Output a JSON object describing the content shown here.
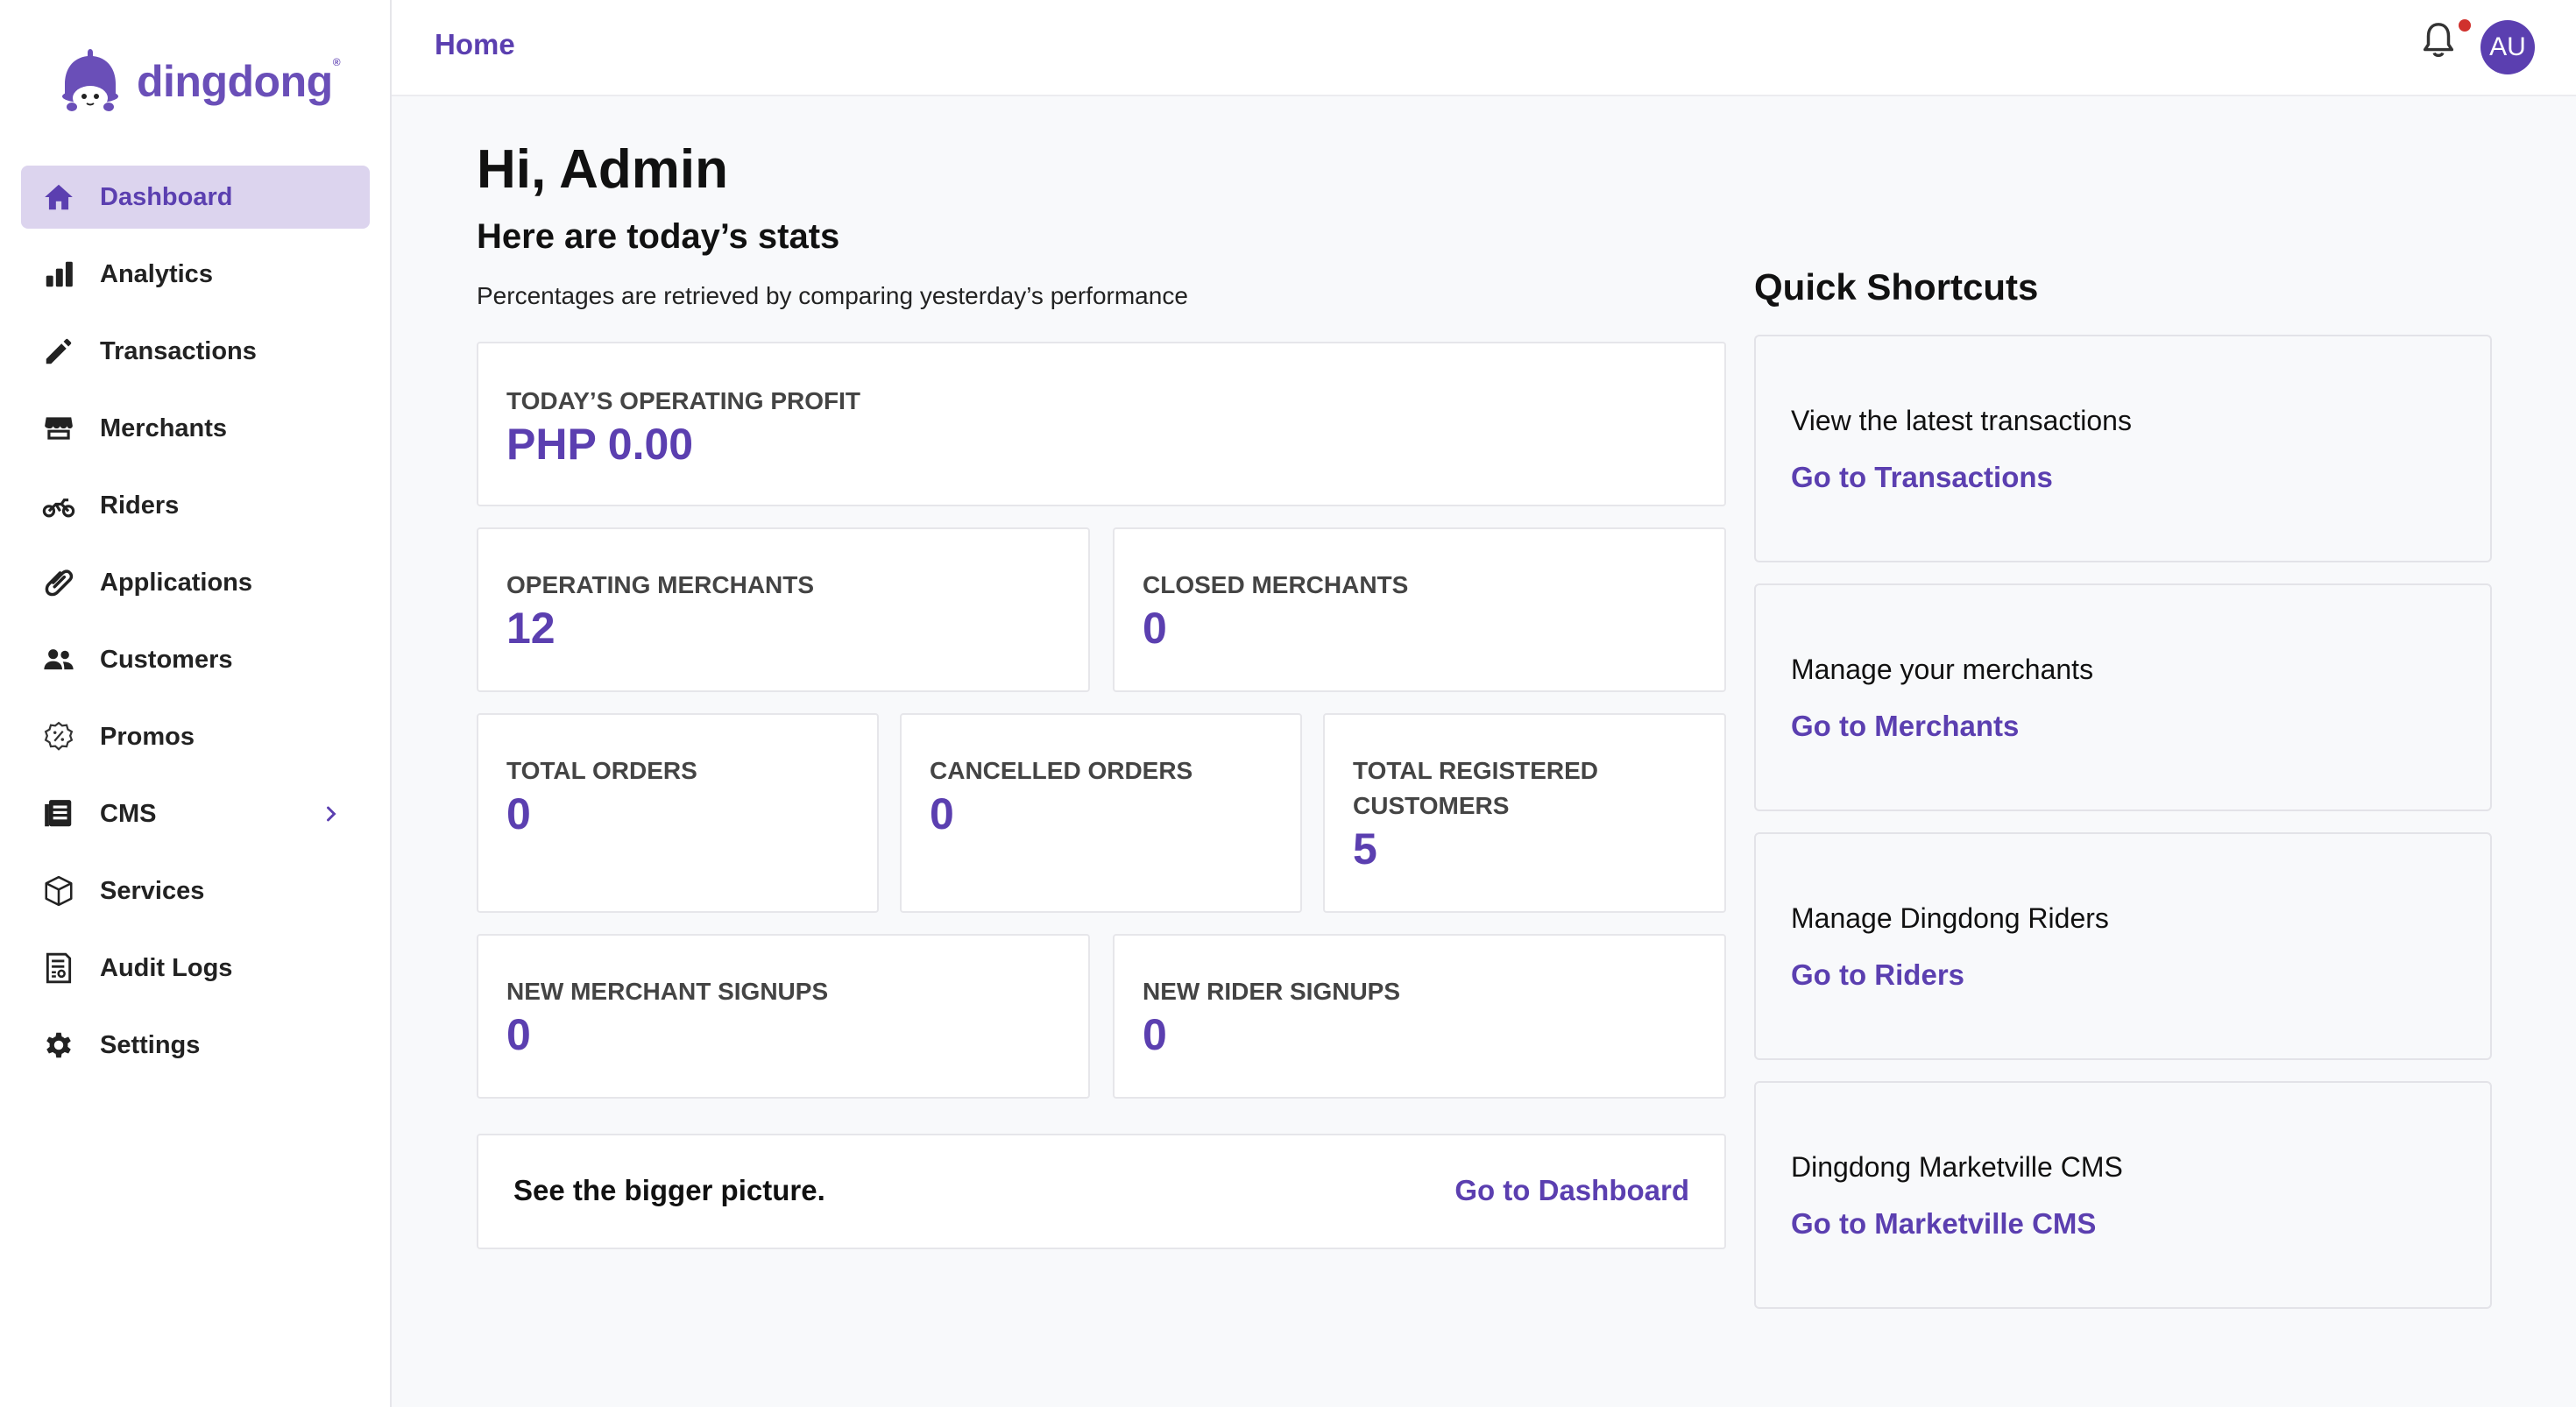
{
  "brand": {
    "name": "dingdong",
    "mark": "®",
    "accent": "#5b3fb0"
  },
  "header": {
    "breadcrumb": "Home",
    "avatar_initials": "AU",
    "notification_dot": true
  },
  "sidebar": {
    "items": [
      {
        "label": "Dashboard",
        "icon": "home-icon",
        "active": true
      },
      {
        "label": "Analytics",
        "icon": "bar-chart-icon"
      },
      {
        "label": "Transactions",
        "icon": "pencil-icon"
      },
      {
        "label": "Merchants",
        "icon": "store-icon"
      },
      {
        "label": "Riders",
        "icon": "motorcycle-icon"
      },
      {
        "label": "Applications",
        "icon": "paperclip-icon"
      },
      {
        "label": "Customers",
        "icon": "users-icon"
      },
      {
        "label": "Promos",
        "icon": "discount-badge-icon"
      },
      {
        "label": "CMS",
        "icon": "document-list-icon",
        "expandable": true
      },
      {
        "label": "Services",
        "icon": "box-icon"
      },
      {
        "label": "Audit Logs",
        "icon": "audit-log-icon"
      },
      {
        "label": "Settings",
        "icon": "gear-icon"
      }
    ]
  },
  "main": {
    "greeting": "Hi, Admin",
    "subheading": "Here are today’s stats",
    "note": "Percentages are retrieved by comparing yesterday’s performance",
    "stats": {
      "operating_profit": {
        "label": "TODAY’S OPERATING PROFIT",
        "value": "PHP 0.00"
      },
      "operating_merchants": {
        "label": "OPERATING MERCHANTS",
        "value": "12"
      },
      "closed_merchants": {
        "label": "CLOSED MERCHANTS",
        "value": "0"
      },
      "total_orders": {
        "label": "TOTAL ORDERS",
        "value": "0"
      },
      "cancelled_orders": {
        "label": "CANCELLED ORDERS",
        "value": "0"
      },
      "registered_customers": {
        "label_line1": "TOTAL REGISTERED",
        "label_line2": "CUSTOMERS",
        "value": "5"
      },
      "new_merchant_signups": {
        "label": "NEW MERCHANT SIGNUPS",
        "value": "0"
      },
      "new_rider_signups": {
        "label": "NEW RIDER SIGNUPS",
        "value": "0"
      }
    },
    "bigger_picture": {
      "text": "See the bigger picture.",
      "link": "Go to Dashboard"
    }
  },
  "shortcuts": {
    "title": "Quick Shortcuts",
    "items": [
      {
        "text": "View the latest transactions",
        "link": "Go to Transactions"
      },
      {
        "text": "Manage your merchants",
        "link": "Go to Merchants"
      },
      {
        "text": "Manage Dingdong Riders",
        "link": "Go to Riders"
      },
      {
        "text": "Dingdong Marketville CMS",
        "link": "Go to Marketville CMS"
      }
    ]
  }
}
